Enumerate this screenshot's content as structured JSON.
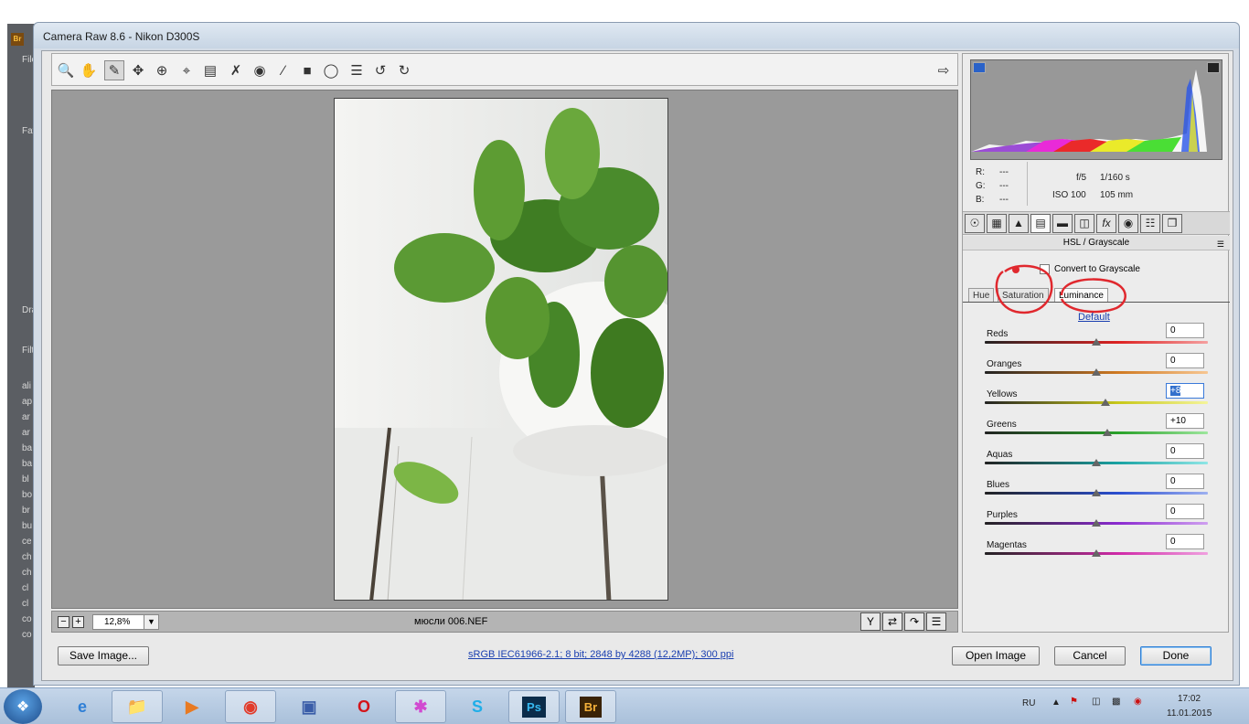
{
  "bridge": {
    "app_badge": "Br",
    "items": [
      "File",
      "Fav",
      "Dra",
      "Filt",
      "ali",
      "ap",
      "ar",
      "ar",
      "ba",
      "ba",
      "bl",
      "bo",
      "br",
      "bu",
      "ce",
      "ch",
      "ch",
      "cl",
      "cl",
      "co",
      "co"
    ]
  },
  "window": {
    "title": "Camera Raw 8.6  -  Nikon D300S"
  },
  "toolbar": {
    "tools": [
      "zoom-icon",
      "hand-icon",
      "white-balance-icon",
      "color-sampler-icon",
      "target-adjustment-icon",
      "crop-icon",
      "straighten-icon",
      "spot-removal-icon",
      "red-eye-icon",
      "adjustment-brush-icon",
      "graduated-filter-icon",
      "radial-filter-icon",
      "preferences-icon",
      "rotate-left-icon",
      "rotate-right-icon"
    ],
    "fullscreen_icon": "fullscreen-toggle-icon"
  },
  "status": {
    "zoom": "12,8%",
    "filename": "мюсли 006.NEF"
  },
  "info": {
    "r_label": "R:",
    "g_label": "G:",
    "b_label": "B:",
    "r": "---",
    "g": "---",
    "b": "---",
    "aperture": "f/5",
    "shutter": "1/160 s",
    "iso": "ISO 100",
    "focal": "105 mm"
  },
  "panel": {
    "title": "HSL / Grayscale",
    "grayscale_label": "Convert to Grayscale",
    "tabs": [
      "Hue",
      "Saturation",
      "Luminance"
    ],
    "active_tab": "Luminance",
    "default_label": "Default",
    "sliders": [
      {
        "label": "Reds",
        "value": "0",
        "level": 0
      },
      {
        "label": "Oranges",
        "value": "0",
        "level": 0
      },
      {
        "label": "Yellows",
        "value": "+8",
        "level": 8
      },
      {
        "label": "Greens",
        "value": "+10",
        "level": 10
      },
      {
        "label": "Aquas",
        "value": "0",
        "level": 0
      },
      {
        "label": "Blues",
        "value": "0",
        "level": 0
      },
      {
        "label": "Purples",
        "value": "0",
        "level": 0
      },
      {
        "label": "Magentas",
        "value": "0",
        "level": 0
      }
    ]
  },
  "buttons": {
    "save": "Save Image...",
    "workflow": "sRGB IEC61966-2.1; 8 bit; 2848 by 4288 (12,2MP); 300 ppi",
    "open": "Open Image",
    "cancel": "Cancel",
    "done": "Done"
  },
  "taskbar": {
    "apps": [
      "ie-icon",
      "explorer-icon",
      "media-player-icon",
      "chrome-icon",
      "network-icon",
      "opera-icon",
      "paint-icon",
      "skype-icon",
      "photoshop-icon",
      "bridge-icon"
    ],
    "ps_label": "Ps",
    "br_label": "Br",
    "lang": "RU",
    "time": "17:02",
    "date": "11.01.2015"
  },
  "colors": {
    "accent": "#2f7fd6",
    "annotation": "#e0282e"
  }
}
